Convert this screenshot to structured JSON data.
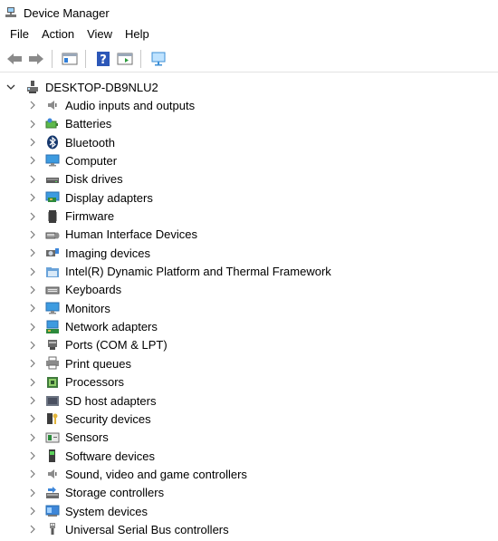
{
  "window": {
    "title": "Device Manager",
    "app_icon": "device-manager-icon"
  },
  "menu": [
    "File",
    "Action",
    "View",
    "Help"
  ],
  "toolbar": {
    "buttons": [
      "back-icon",
      "forward-icon",
      "show-hide-console-tree-icon",
      "help-icon",
      "action-pane-icon",
      "monitor-scan-icon"
    ]
  },
  "tree": {
    "root": {
      "label": "DESKTOP-DB9NLU2",
      "icon": "computer-tower-icon",
      "expanded": true
    },
    "categories": [
      {
        "label": "Audio inputs and outputs",
        "icon": "speaker-icon"
      },
      {
        "label": "Batteries",
        "icon": "battery-icon"
      },
      {
        "label": "Bluetooth",
        "icon": "bluetooth-icon"
      },
      {
        "label": "Computer",
        "icon": "computer-icon"
      },
      {
        "label": "Disk drives",
        "icon": "disk-drive-icon"
      },
      {
        "label": "Display adapters",
        "icon": "display-adapter-icon"
      },
      {
        "label": "Firmware",
        "icon": "firmware-icon"
      },
      {
        "label": "Human Interface Devices",
        "icon": "hid-icon"
      },
      {
        "label": "Imaging devices",
        "icon": "camera-icon"
      },
      {
        "label": "Intel(R) Dynamic Platform and Thermal Framework",
        "icon": "folder-icon"
      },
      {
        "label": "Keyboards",
        "icon": "keyboard-icon"
      },
      {
        "label": "Monitors",
        "icon": "monitor-icon"
      },
      {
        "label": "Network adapters",
        "icon": "network-adapter-icon"
      },
      {
        "label": "Ports (COM & LPT)",
        "icon": "port-icon"
      },
      {
        "label": "Print queues",
        "icon": "printer-icon"
      },
      {
        "label": "Processors",
        "icon": "processor-icon"
      },
      {
        "label": "SD host adapters",
        "icon": "sd-card-icon"
      },
      {
        "label": "Security devices",
        "icon": "security-key-icon"
      },
      {
        "label": "Sensors",
        "icon": "sensor-icon"
      },
      {
        "label": "Software devices",
        "icon": "software-device-icon"
      },
      {
        "label": "Sound, video and game controllers",
        "icon": "speaker-icon"
      },
      {
        "label": "Storage controllers",
        "icon": "storage-controller-icon"
      },
      {
        "label": "System devices",
        "icon": "system-device-icon"
      },
      {
        "label": "Universal Serial Bus controllers",
        "icon": "usb-icon"
      }
    ]
  },
  "colors": {
    "chevron": "#7a7a7a",
    "accent_blue": "#1e7bd6",
    "toolbar_separator": "#c8c8c8"
  }
}
